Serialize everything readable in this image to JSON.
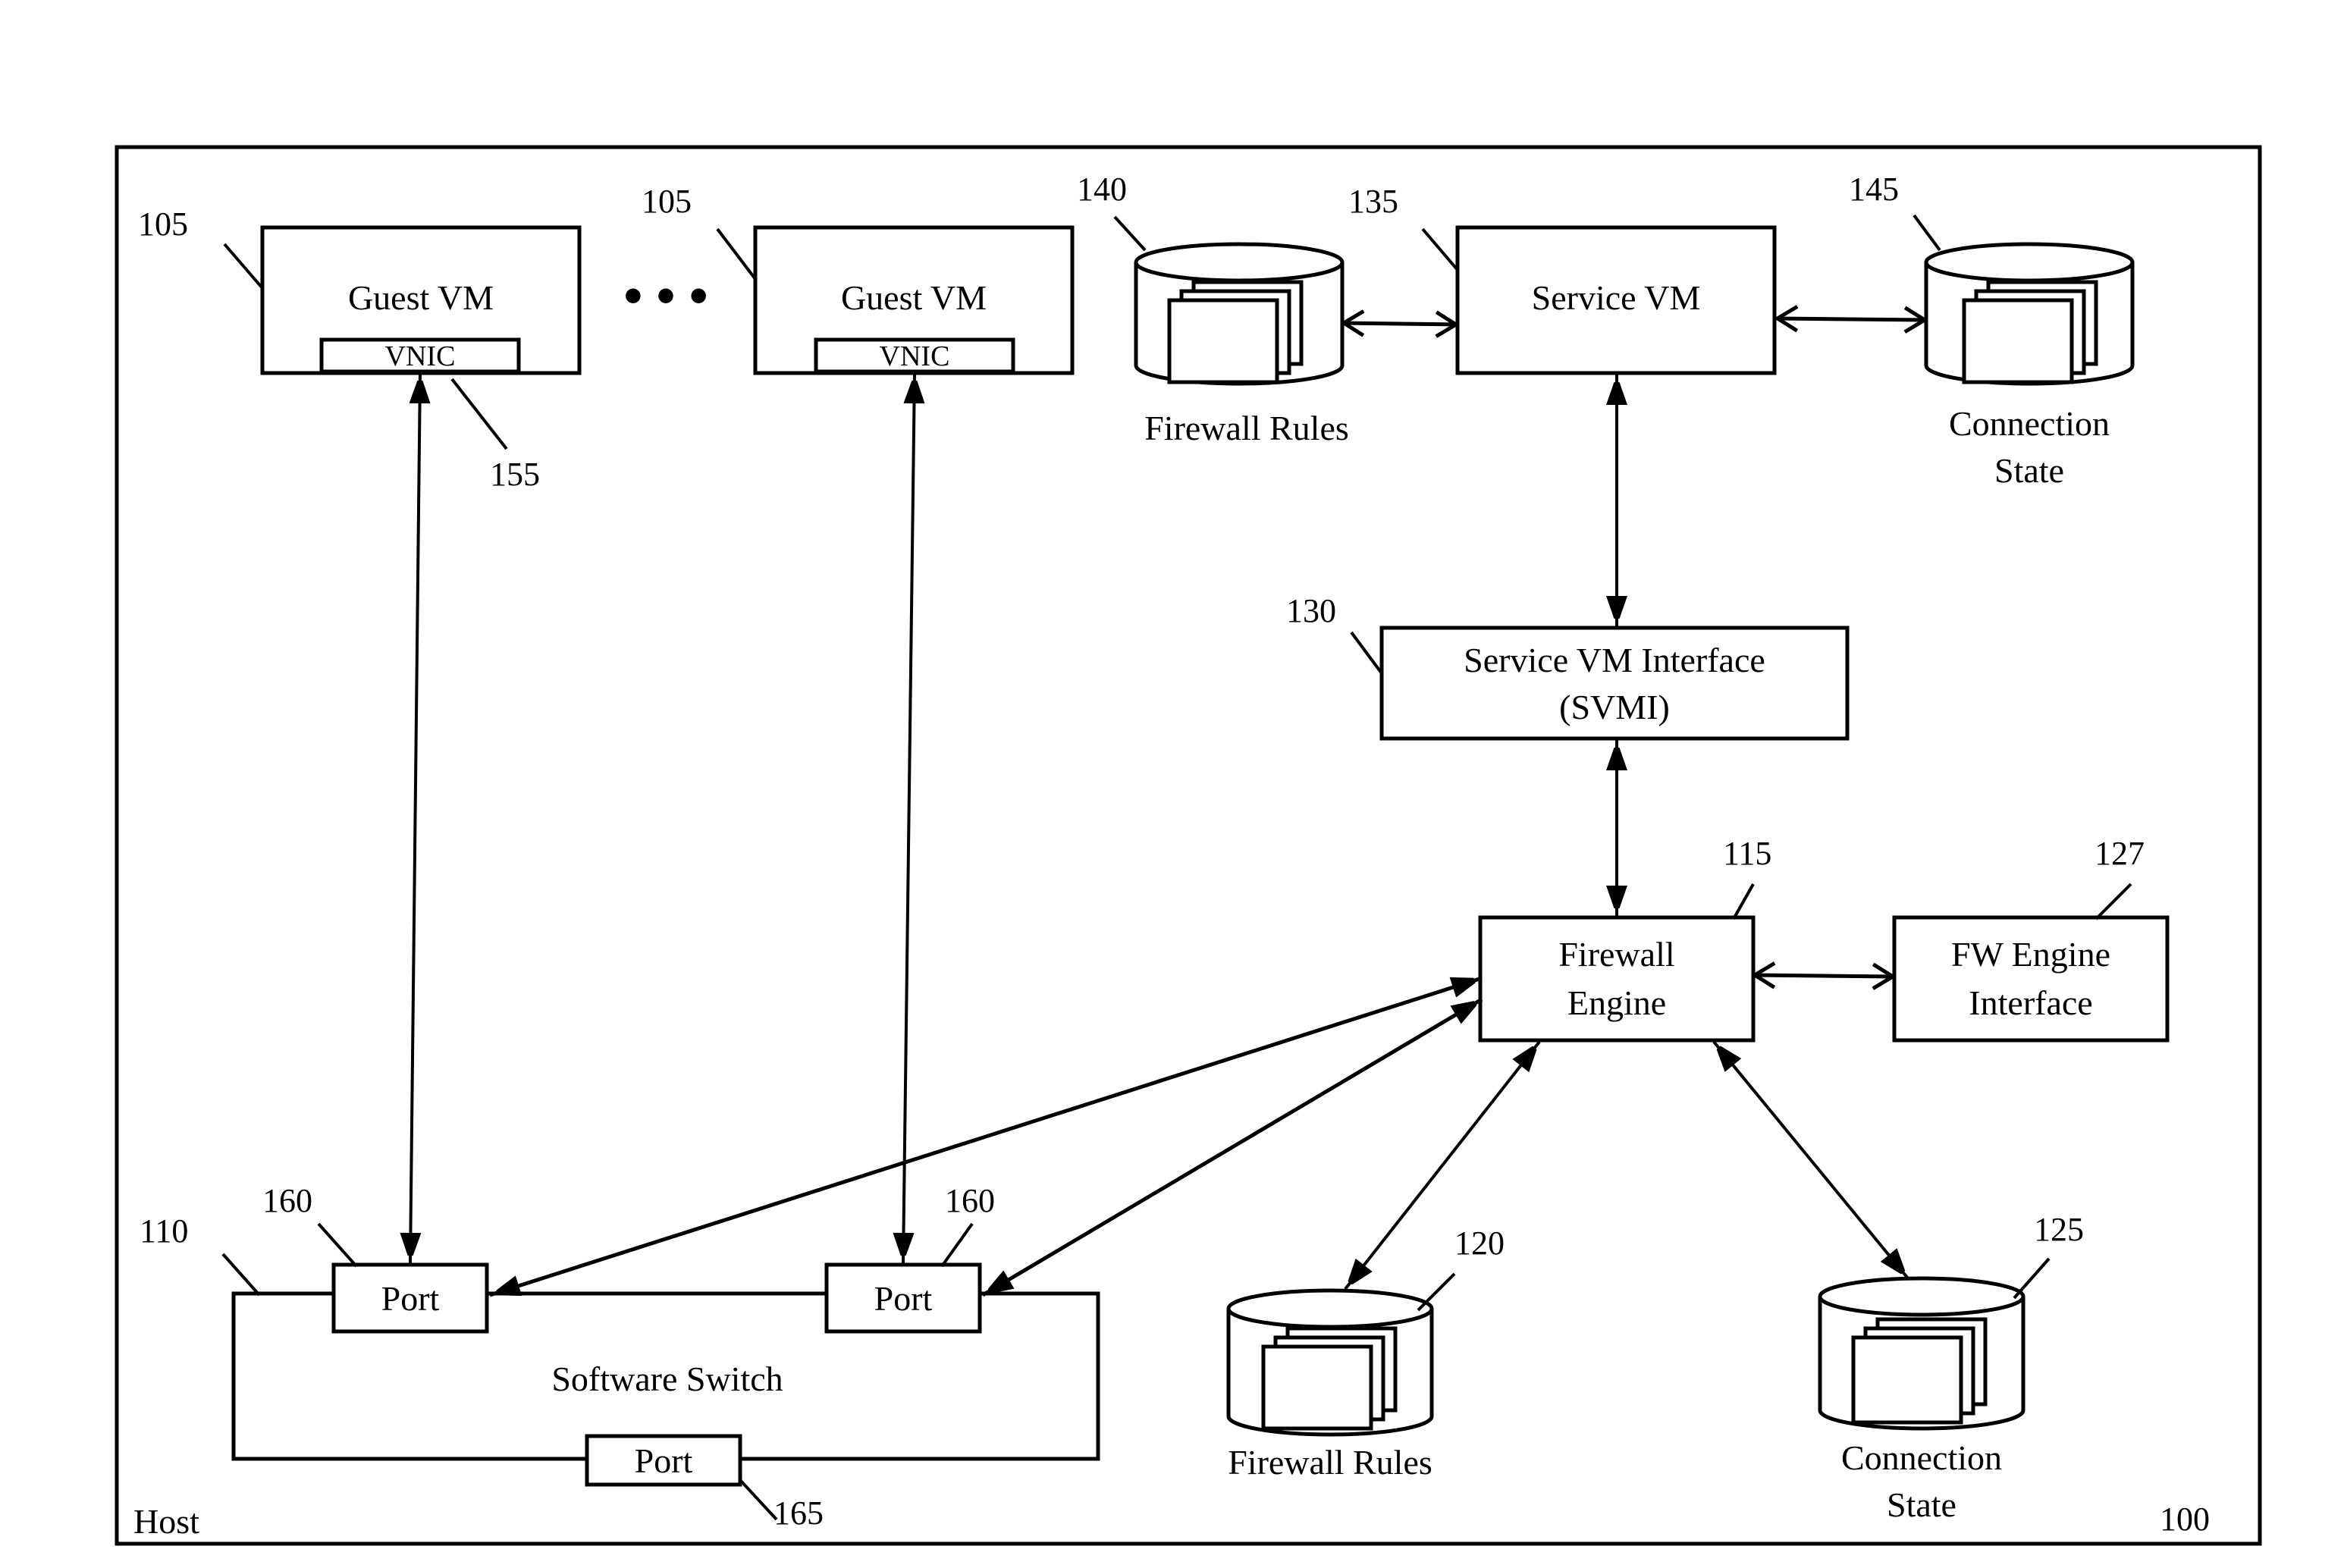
{
  "diagram": {
    "container": {
      "label": "Host",
      "ref": "100"
    },
    "guest_vms": [
      {
        "label": "Guest VM",
        "ref": "105",
        "vnic": "VNIC"
      },
      {
        "label": "Guest VM",
        "ref": "105",
        "vnic": "VNIC"
      }
    ],
    "vnic_ref": "155",
    "ellipsis": "• • •",
    "service_vm": {
      "label": "Service VM",
      "ref": "135"
    },
    "service_fw_rules": {
      "label": "Firewall Rules",
      "ref": "140"
    },
    "service_conn_state": {
      "label_line1": "Connection",
      "label_line2": "State",
      "ref": "145"
    },
    "svmi": {
      "label_line1": "Service VM Interface",
      "label_line2": "(SVMI)",
      "ref": "130"
    },
    "firewall_engine": {
      "label_line1": "Firewall",
      "label_line2": "Engine",
      "ref": "115"
    },
    "fw_engine_interface": {
      "label_line1": "FW Engine",
      "label_line2": "Interface",
      "ref": "127"
    },
    "fw_rules": {
      "label": "Firewall Rules",
      "ref": "120"
    },
    "conn_state": {
      "label_line1": "Connection",
      "label_line2": "State",
      "ref": "125"
    },
    "software_switch": {
      "label": "Software Switch",
      "ref": "110",
      "ports": [
        {
          "label": "Port",
          "ref": "160"
        },
        {
          "label": "Port",
          "ref": "160"
        },
        {
          "label": "Port",
          "ref": "165"
        }
      ]
    }
  }
}
